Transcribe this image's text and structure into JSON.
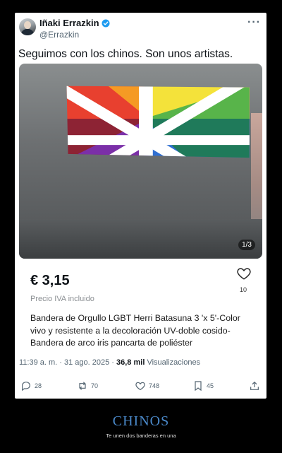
{
  "post": {
    "author_name": "Iñaki Errazkin",
    "handle": "@Errazkin",
    "more_label": "···",
    "text": "Seguimos con los chinos. Son unos artistas.",
    "media_counter": "1/3",
    "timestamp": "11:39 a. m. · 31 ago. 2025 ·",
    "views_count": "36,8 mil",
    "views_label": "Visualizaciones",
    "replies": "28",
    "reposts": "70",
    "likes": "748",
    "bookmarks": "45"
  },
  "product": {
    "price": "€ 3,15",
    "price_note": "Precio IVA incluido",
    "favorites": "10",
    "description": "Bandera de Orgullo LGBT Herri Batasuna 3 'x 5'-Color vivo y resistente a la decoloración UV-doble cosido-Bandera de arco iris pancarta de poliéster"
  },
  "flag_colors": [
    "#e8402f",
    "#f59a24",
    "#f4e23a",
    "#58b44a",
    "#2f6fd2",
    "#7b2fa8"
  ],
  "accent_color": "#1d9bf0",
  "caption": {
    "title": "CHINOS",
    "subtitle": "Te unen dos banderas en una"
  }
}
